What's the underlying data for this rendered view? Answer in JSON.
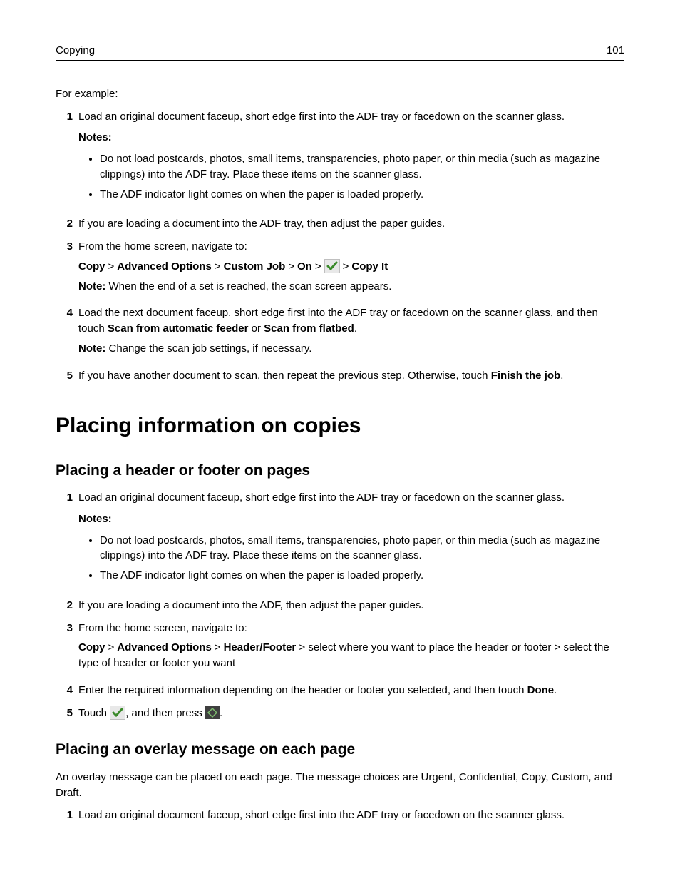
{
  "header": {
    "section": "Copying",
    "page": "101"
  },
  "intro": "For example:",
  "steps1": {
    "s1": {
      "text": "Load an original document faceup, short edge first into the ADF tray or facedown on the scanner glass.",
      "notes_label": "Notes:",
      "note_a": "Do not load postcards, photos, small items, transparencies, photo paper, or thin media (such as magazine clippings) into the ADF tray. Place these items on the scanner glass.",
      "note_b": "The ADF indicator light comes on when the paper is loaded properly."
    },
    "s2": "If you are loading a document into the ADF tray, then adjust the paper guides.",
    "s3": {
      "text": "From the home screen, navigate to:",
      "path": {
        "p1": "Copy",
        "p2": "Advanced Options",
        "p3": "Custom Job",
        "p4": "On",
        "p5": "Copy It"
      },
      "note_label": "Note:",
      "note_text": " When the end of a set is reached, the scan screen appears."
    },
    "s4": {
      "pre": "Load the next document faceup, short edge first into the ADF tray or facedown on the scanner glass, and then touch ",
      "opt1": "Scan from automatic feeder",
      "mid": " or ",
      "opt2": "Scan from flatbed",
      "post": ".",
      "note_label": "Note:",
      "note_text": " Change the scan job settings, if necessary."
    },
    "s5": {
      "pre": "If you have another document to scan, then repeat the previous step. Otherwise, touch ",
      "bold": "Finish the job",
      "post": "."
    }
  },
  "h1": "Placing information on copies",
  "sub1": {
    "title": "Placing a header or footer on pages",
    "s1": {
      "text": "Load an original document faceup, short edge first into the ADF tray or facedown on the scanner glass.",
      "notes_label": "Notes:",
      "note_a": "Do not load postcards, photos, small items, transparencies, photo paper, or thin media (such as magazine clippings) into the ADF tray. Place these items on the scanner glass.",
      "note_b": "The ADF indicator light comes on when the paper is loaded properly."
    },
    "s2": "If you are loading a document into the ADF, then adjust the paper guides.",
    "s3": {
      "text": "From the home screen, navigate to:",
      "p1": "Copy",
      "p2": "Advanced Options",
      "p3": "Header/Footer",
      "rest": " > select where you want to place the header or footer > select the type of header or footer you want"
    },
    "s4": {
      "pre": "Enter the required information depending on the header or footer you selected, and then touch ",
      "bold": "Done",
      "post": "."
    },
    "s5": {
      "pre": "Touch ",
      "mid": ", and then press ",
      "post": "."
    }
  },
  "sub2": {
    "title": "Placing an overlay message on each page",
    "intro": "An overlay message can be placed on each page. The message choices are Urgent, Confidential, Copy, Custom, and Draft.",
    "s1": "Load an original document faceup, short edge first into the ADF tray or facedown on the scanner glass."
  },
  "sep": ">"
}
